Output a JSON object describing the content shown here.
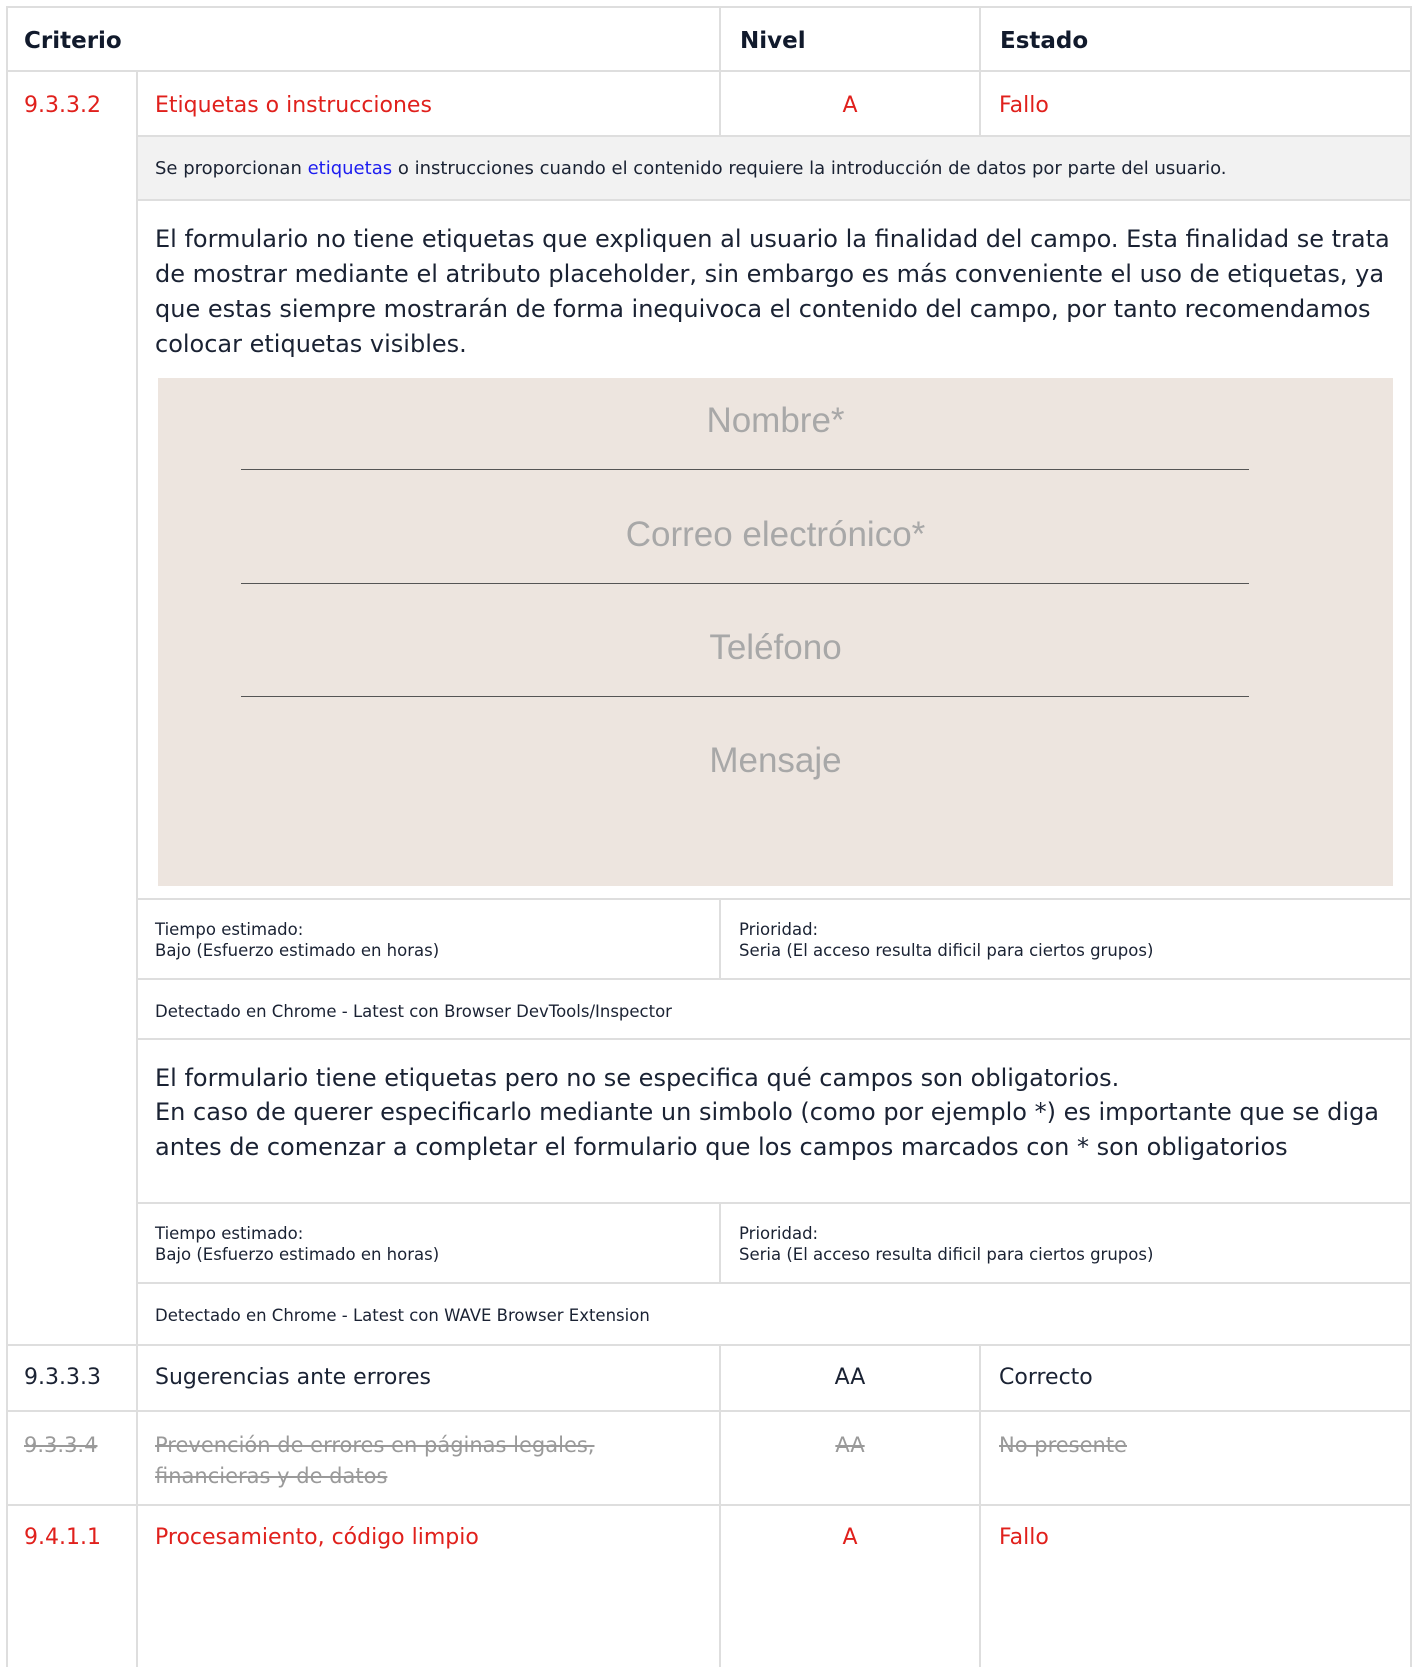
{
  "header": {
    "criterio": "Criterio",
    "nivel": "Nivel",
    "estado": "Estado"
  },
  "criteria": [
    {
      "code": "9.3.3.2",
      "name": "Etiquetas o instrucciones",
      "level": "A",
      "status": "Fallo"
    },
    {
      "code": "9.3.3.3",
      "name": "Sugerencias ante errores",
      "level": "AA",
      "status": "Correcto"
    },
    {
      "code": "9.3.3.4",
      "name": "Prevención de errores en páginas legales, financieras y de datos",
      "level": "AA",
      "status": "No presente"
    },
    {
      "code": "9.4.1.1",
      "name": "Procesamiento, código limpio",
      "level": "A",
      "status": "Fallo"
    }
  ],
  "description": {
    "before": "Se proporcionan ",
    "link": "etiquetas",
    "after": " o instrucciones cuando el contenido requiere la introducción de datos por parte del usuario."
  },
  "issues": [
    {
      "text": "El formulario no tiene etiquetas que expliquen al usuario la finalidad del campo. Esta finalidad se trata de mostrar mediante el atributo placeholder, sin embargo es más conveniente el uso de etiquetas, ya que estas siempre mostrarán de forma inequivoca el contenido del campo, por tanto recomendamos colocar etiquetas visibles.",
      "time_label": "Tiempo estimado:",
      "time_value": "Bajo (Esfuerzo estimado en horas)",
      "priority_label": "Prioridad:",
      "priority_value": "Seria (El acceso resulta dificil para ciertos grupos)",
      "detected": "Detectado en Chrome - Latest con Browser DevTools/Inspector"
    },
    {
      "text_line1": "El formulario tiene etiquetas pero no se especifica qué campos son obligatorios.",
      "text_line2": "En caso de querer especificarlo mediante un simbolo (como por ejemplo *) es importante que se diga antes de comenzar a completar el formulario que los campos marcados con * son obligatorios",
      "time_label": "Tiempo estimado:",
      "time_value": "Bajo (Esfuerzo estimado en horas)",
      "priority_label": "Prioridad:",
      "priority_value": "Seria (El acceso resulta dificil para ciertos grupos)",
      "detected": "Detectado en Chrome - Latest con WAVE Browser Extension"
    }
  ],
  "form_mockup": {
    "placeholders": [
      "Nombre*",
      "Correo electrónico*",
      "Teléfono",
      "Mensaje"
    ]
  },
  "colors": {
    "fail": "#e0201c",
    "link": "#1d1df0",
    "border": "#dedede",
    "form_bg": "#ede5df"
  }
}
